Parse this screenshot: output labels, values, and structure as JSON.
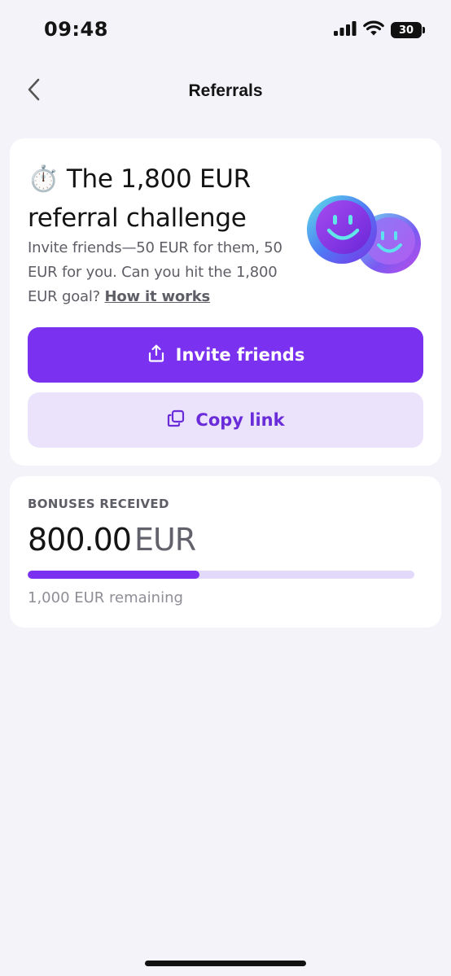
{
  "status_bar": {
    "time": "09:48",
    "battery": "30"
  },
  "nav": {
    "title": "Referrals",
    "back_icon": "chevron-left-icon"
  },
  "challenge": {
    "emoji": "⏱️",
    "title": "The 1,800 EUR referral challenge",
    "description": "Invite friends—50 EUR for them, 50 EUR for you. Can you hit the 1,800 EUR goal?",
    "link_label": "How it works",
    "invite_button_label": "Invite friends",
    "invite_icon": "share-icon",
    "copy_button_label": "Copy link",
    "copy_icon": "copy-icon"
  },
  "bonuses": {
    "label": "BONUSES RECEIVED",
    "amount": "800.00",
    "currency": "EUR",
    "progress_percent": 44.4,
    "remaining_text": "1,000 EUR remaining"
  },
  "colors": {
    "accent": "#7A32F0",
    "accent_soft": "#EAE3FB",
    "background": "#F4F3FA"
  }
}
